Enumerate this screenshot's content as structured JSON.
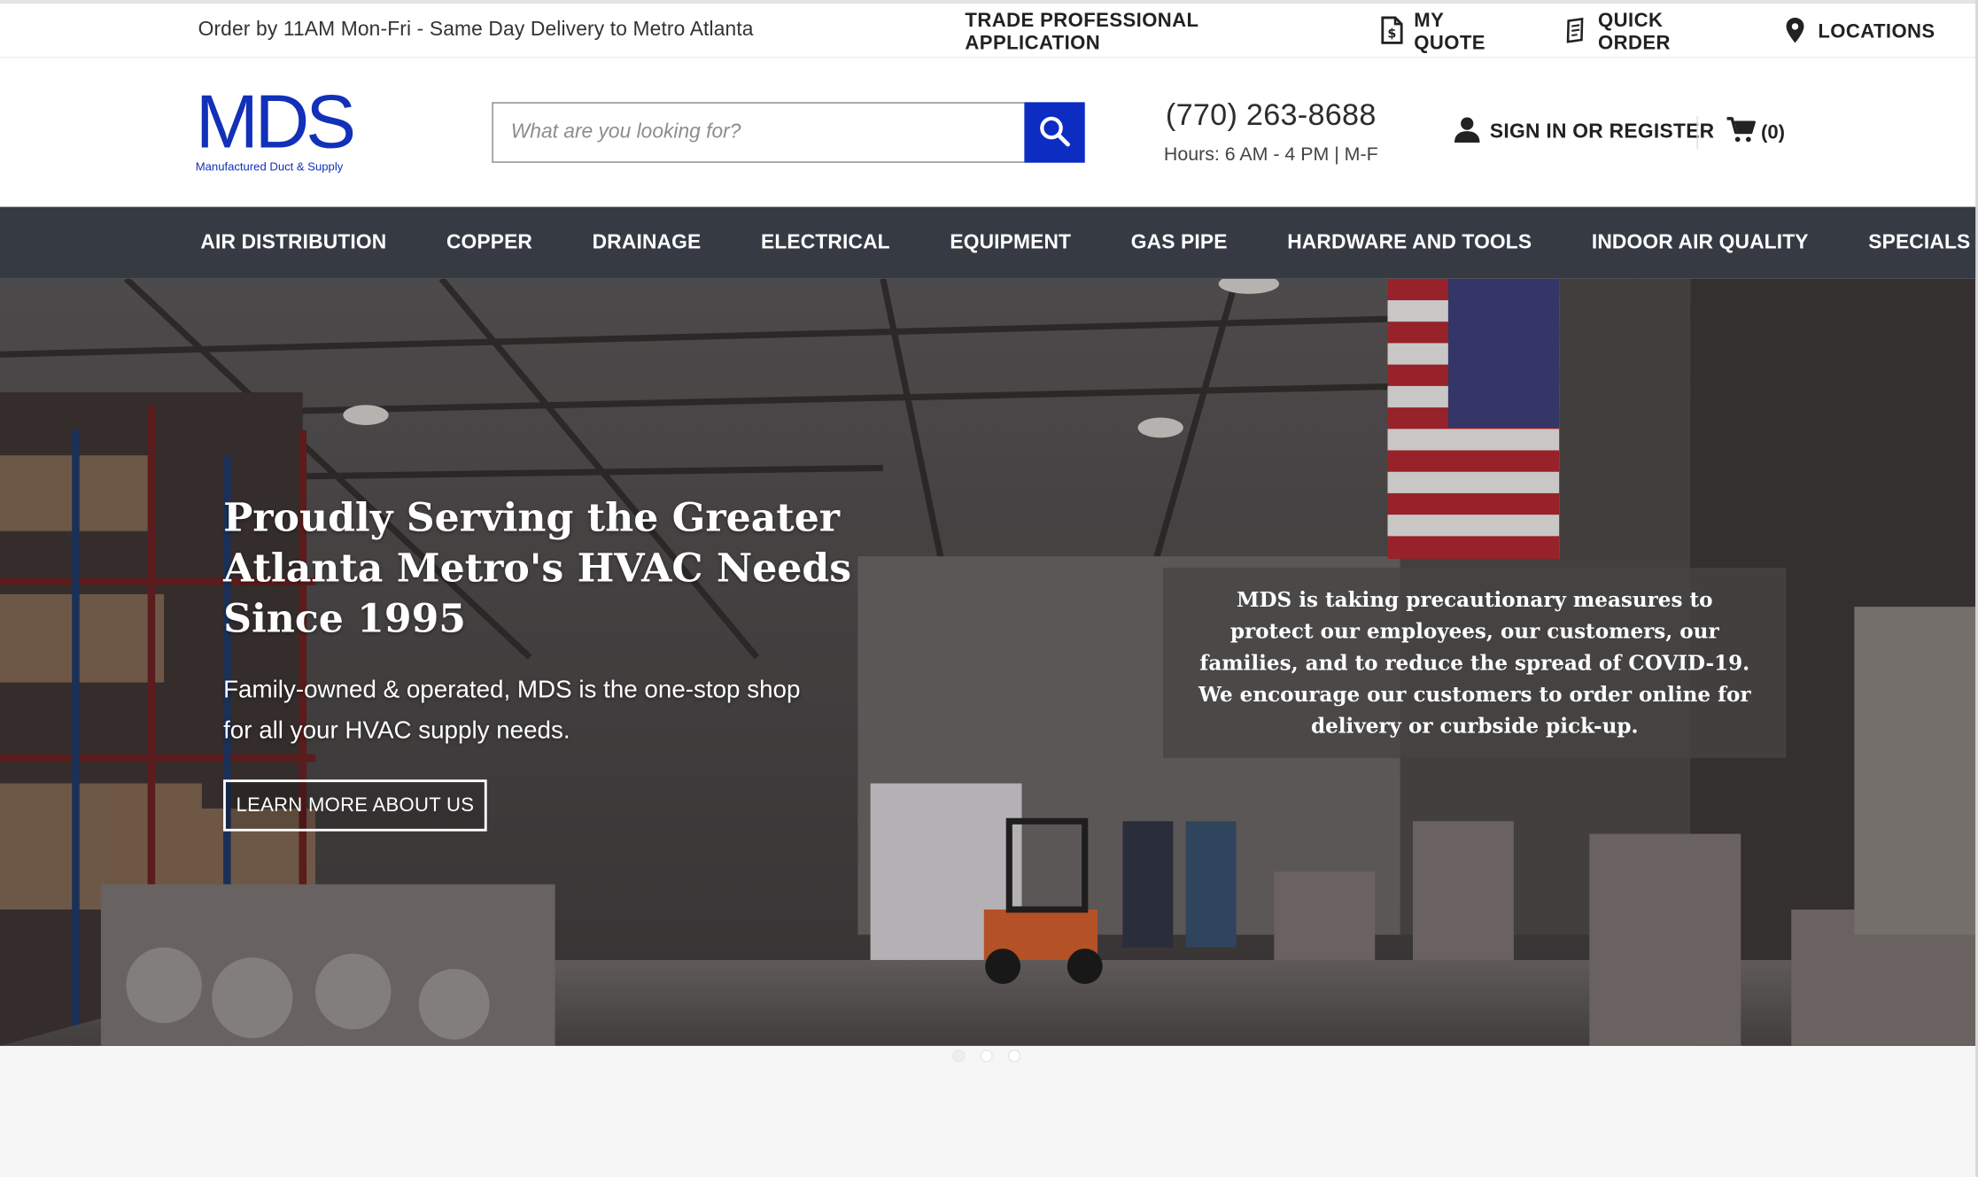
{
  "topbar": {
    "promo": "Order by 11AM Mon-Fri - Same Day Delivery to Metro Atlanta",
    "links": [
      {
        "label": "TRADE PROFESSIONAL APPLICATION",
        "icon": "none"
      },
      {
        "label": "MY QUOTE",
        "icon": "quote-document-icon"
      },
      {
        "label": "QUICK ORDER",
        "icon": "quick-order-icon"
      },
      {
        "label": "LOCATIONS",
        "icon": "map-pin-icon"
      }
    ]
  },
  "header": {
    "logo_mark": "MDS",
    "logo_sub": "Manufactured Duct & Supply",
    "search_placeholder": "What are you looking for?",
    "phone": "(770) 263-8688",
    "hours": "Hours: 6 AM - 4 PM | M-F",
    "account_label": "SIGN IN OR REGISTER",
    "cart_label": "(0)"
  },
  "nav": {
    "items": [
      "AIR DISTRIBUTION",
      "COPPER",
      "DRAINAGE",
      "ELECTRICAL",
      "EQUIPMENT",
      "GAS PIPE",
      "HARDWARE AND TOOLS",
      "INDOOR AIR QUALITY",
      "SPECIALS"
    ]
  },
  "hero": {
    "headline": "Proudly Serving the Greater Atlanta Metro's HVAC Needs Since 1995",
    "lede": "Family-owned & operated, MDS is the one-stop shop for all your HVAC supply needs.",
    "cta": "LEARN MORE ABOUT US",
    "notice": "MDS is taking precautionary measures to protect our employees, our customers, our families, and to reduce the spread of COVID-19. We encourage our customers to order online for delivery or curbside pick-up.",
    "slides_total": 3,
    "slide_active": 1
  },
  "colors": {
    "brand_blue": "#1230b8",
    "search_button": "#0d2cc2",
    "nav_bg": "#363a43"
  }
}
